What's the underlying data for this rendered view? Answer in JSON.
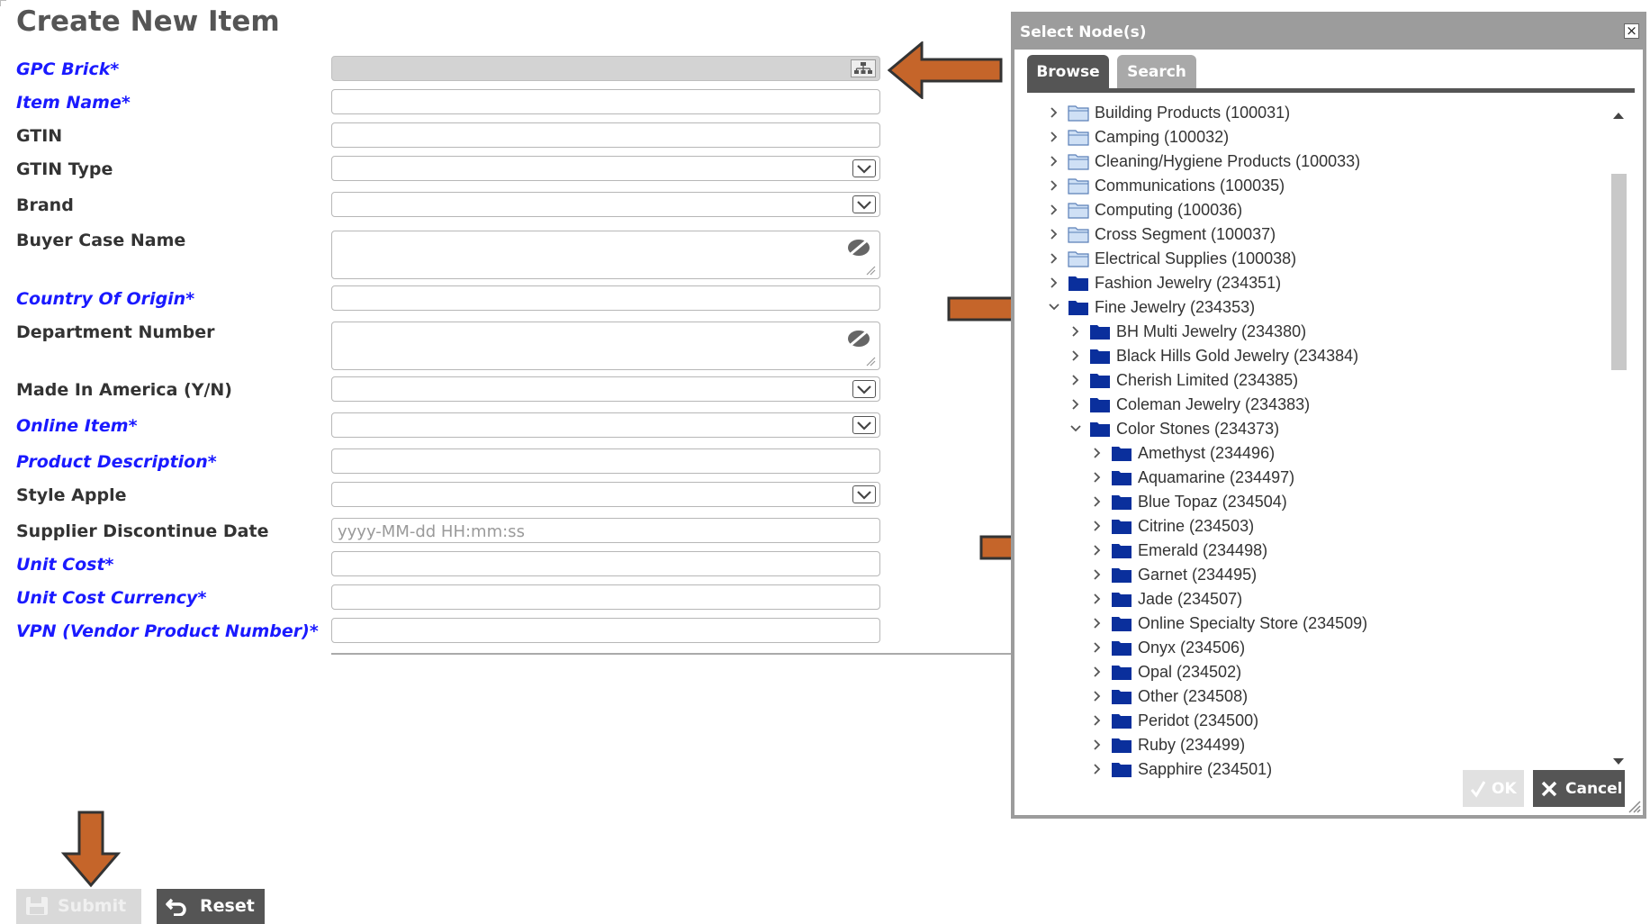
{
  "form": {
    "title": "Create New Item",
    "fields": [
      {
        "label": "GPC Brick*",
        "required": true,
        "type": "tree",
        "value": ""
      },
      {
        "label": "Item Name*",
        "required": true,
        "type": "text",
        "value": ""
      },
      {
        "label": "GTIN",
        "required": false,
        "type": "text",
        "value": ""
      },
      {
        "label": "GTIN Type",
        "required": false,
        "type": "select",
        "value": ""
      },
      {
        "label": "Brand",
        "required": false,
        "type": "select",
        "value": ""
      },
      {
        "label": "Buyer Case Name",
        "required": false,
        "type": "textarea",
        "value": ""
      },
      {
        "label": "Country Of Origin*",
        "required": true,
        "type": "text",
        "value": ""
      },
      {
        "label": "Department Number",
        "required": false,
        "type": "textarea",
        "value": ""
      },
      {
        "label": "Made In America (Y/N)",
        "required": false,
        "type": "select",
        "value": ""
      },
      {
        "label": "Online Item*",
        "required": true,
        "type": "select",
        "value": ""
      },
      {
        "label": "Product Description*",
        "required": true,
        "type": "text",
        "value": ""
      },
      {
        "label": "Style Apple",
        "required": false,
        "type": "select",
        "value": ""
      },
      {
        "label": "Supplier Discontinue Date",
        "required": false,
        "type": "date",
        "value": "",
        "placeholder": "yyyy-MM-dd HH:mm:ss"
      },
      {
        "label": "Unit Cost*",
        "required": true,
        "type": "text",
        "value": ""
      },
      {
        "label": "Unit Cost Currency*",
        "required": true,
        "type": "text",
        "value": ""
      },
      {
        "label": "VPN (Vendor Product Number)*",
        "required": true,
        "type": "text",
        "value": ""
      }
    ],
    "submit_label": "Submit",
    "reset_label": "Reset"
  },
  "dialog": {
    "title": "Select Node(s)",
    "close_glyph": "×",
    "tabs": [
      {
        "label": "Browse",
        "active": true
      },
      {
        "label": "Search",
        "active": false
      }
    ],
    "tree": [
      {
        "label": "Building Products (100031)",
        "depth": 0,
        "expanded": false,
        "style": "light"
      },
      {
        "label": "Camping (100032)",
        "depth": 0,
        "expanded": false,
        "style": "light"
      },
      {
        "label": "Cleaning/Hygiene Products (100033)",
        "depth": 0,
        "expanded": false,
        "style": "light"
      },
      {
        "label": "Communications (100035)",
        "depth": 0,
        "expanded": false,
        "style": "light"
      },
      {
        "label": "Computing (100036)",
        "depth": 0,
        "expanded": false,
        "style": "light"
      },
      {
        "label": "Cross Segment (100037)",
        "depth": 0,
        "expanded": false,
        "style": "light"
      },
      {
        "label": "Electrical Supplies (100038)",
        "depth": 0,
        "expanded": false,
        "style": "light"
      },
      {
        "label": "Fashion Jewelry (234351)",
        "depth": 0,
        "expanded": false,
        "style": "dark"
      },
      {
        "label": "Fine Jewelry (234353)",
        "depth": 0,
        "expanded": true,
        "style": "dark"
      },
      {
        "label": "BH Multi Jewelry (234380)",
        "depth": 1,
        "expanded": false,
        "style": "dark"
      },
      {
        "label": "Black Hills Gold Jewelry (234384)",
        "depth": 1,
        "expanded": false,
        "style": "dark"
      },
      {
        "label": "Cherish Limited (234385)",
        "depth": 1,
        "expanded": false,
        "style": "dark"
      },
      {
        "label": "Coleman Jewelry (234383)",
        "depth": 1,
        "expanded": false,
        "style": "dark"
      },
      {
        "label": "Color Stones (234373)",
        "depth": 1,
        "expanded": true,
        "style": "dark"
      },
      {
        "label": "Amethyst (234496)",
        "depth": 2,
        "expanded": false,
        "style": "dark"
      },
      {
        "label": "Aquamarine (234497)",
        "depth": 2,
        "expanded": false,
        "style": "dark"
      },
      {
        "label": "Blue Topaz (234504)",
        "depth": 2,
        "expanded": false,
        "style": "dark"
      },
      {
        "label": "Citrine (234503)",
        "depth": 2,
        "expanded": false,
        "style": "dark"
      },
      {
        "label": "Emerald (234498)",
        "depth": 2,
        "expanded": false,
        "style": "dark"
      },
      {
        "label": "Garnet (234495)",
        "depth": 2,
        "expanded": false,
        "style": "dark"
      },
      {
        "label": "Jade (234507)",
        "depth": 2,
        "expanded": false,
        "style": "dark"
      },
      {
        "label": "Online Specialty Store (234509)",
        "depth": 2,
        "expanded": false,
        "style": "dark"
      },
      {
        "label": "Onyx (234506)",
        "depth": 2,
        "expanded": false,
        "style": "dark"
      },
      {
        "label": "Opal (234502)",
        "depth": 2,
        "expanded": false,
        "style": "dark"
      },
      {
        "label": "Other (234508)",
        "depth": 2,
        "expanded": false,
        "style": "dark"
      },
      {
        "label": "Peridot (234500)",
        "depth": 2,
        "expanded": false,
        "style": "dark"
      },
      {
        "label": "Ruby (234499)",
        "depth": 2,
        "expanded": false,
        "style": "dark"
      },
      {
        "label": "Sapphire (234501)",
        "depth": 2,
        "expanded": false,
        "style": "dark"
      }
    ],
    "ok_label": "OK",
    "cancel_label": "Cancel"
  },
  "colors": {
    "required_label": "#1a1aff",
    "annotation_arrow": "#c5652a",
    "folder_dark": "#0a2f9c",
    "folder_light": "#cfe0f5",
    "dialog_border": "#9c9c9c",
    "dark_button": "#555555"
  }
}
